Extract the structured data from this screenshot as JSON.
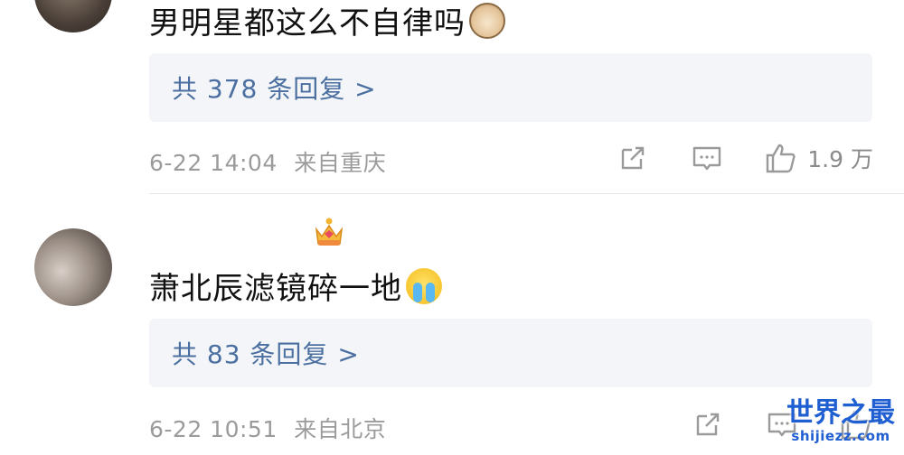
{
  "comments": [
    {
      "text": "男明星都这么不自律吗",
      "emoji": "cat-face-emoji",
      "replies_label": "共 378 条回复 >",
      "timestamp": "6-22 14:04",
      "location": "来自重庆",
      "likes": "1.9 万"
    },
    {
      "text": "萧北辰滤镜碎一地",
      "emoji": "crying-face-emoji",
      "badge": "crown-icon",
      "replies_label": "共 83 条回复 >",
      "timestamp": "6-22 10:51",
      "location": "来自北京",
      "likes": ""
    }
  ],
  "watermark": {
    "title": "世界之最",
    "url": "shijiezz.com"
  },
  "colors": {
    "reply_link": "#4a6fa0",
    "meta_text": "#9b9b9b",
    "reply_bg": "#f3f5f8",
    "watermark": "#1f5fd1"
  }
}
